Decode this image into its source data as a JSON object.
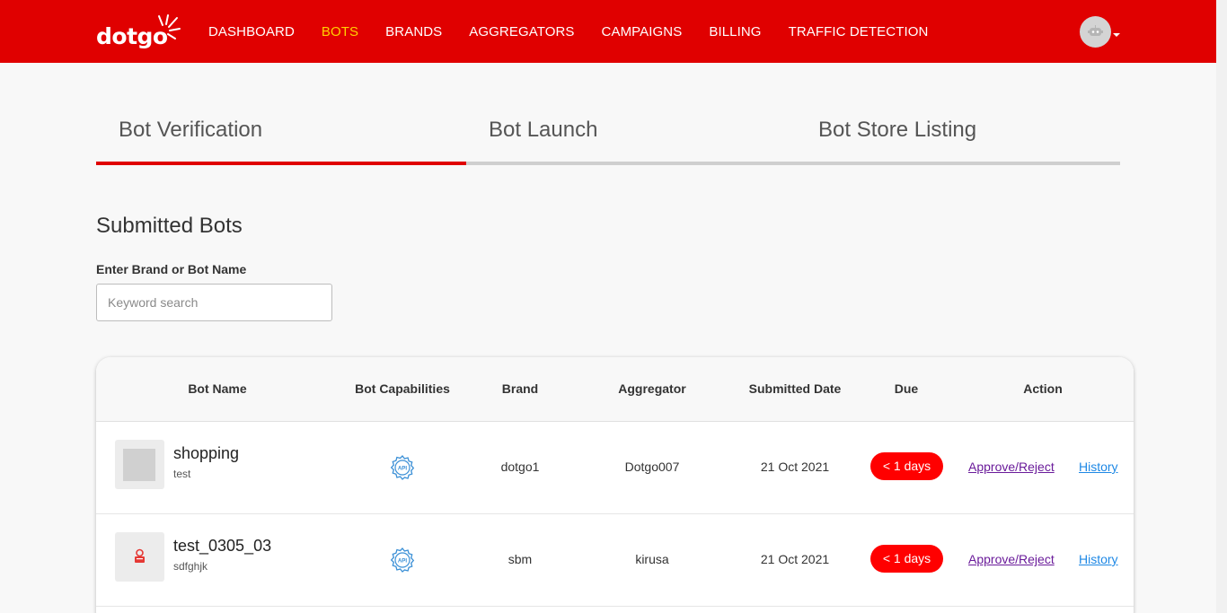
{
  "brand": {
    "logo_text": "dotgo",
    "logo_icon": "sunburst-icon",
    "color": "#e00000"
  },
  "nav": {
    "items": [
      {
        "label": "DASHBOARD",
        "active": false
      },
      {
        "label": "BOTS",
        "active": true
      },
      {
        "label": "BRANDS",
        "active": false
      },
      {
        "label": "AGGREGATORS",
        "active": false
      },
      {
        "label": "CAMPAIGNS",
        "active": false
      },
      {
        "label": "BILLING",
        "active": false
      },
      {
        "label": "TRAFFIC DETECTION",
        "active": false
      }
    ],
    "active_color": "#ffd200"
  },
  "user": {
    "avatar_icon": "robot-avatar-icon"
  },
  "tabs": [
    {
      "label": "Bot Verification",
      "active": true
    },
    {
      "label": "Bot Launch",
      "active": false
    },
    {
      "label": "Bot Store Listing",
      "active": false
    }
  ],
  "section": {
    "title": "Submitted Bots"
  },
  "search": {
    "label": "Enter Brand or Bot Name",
    "placeholder": "Keyword search",
    "value": ""
  },
  "table": {
    "headers": [
      "Bot Name",
      "Bot Capabilities",
      "Brand",
      "Aggregator",
      "Submitted Date",
      "Due",
      "Action"
    ],
    "rows": [
      {
        "bot_name": "shopping",
        "bot_desc": "test",
        "capability_icon": "api-gear-icon",
        "brand": "dotgo1",
        "aggregator": "Dotgo007",
        "submitted_date": "21 Oct 2021",
        "due": "< 1 days",
        "approve_label": "Approve/Reject",
        "history_label": "History"
      },
      {
        "bot_name": "test_0305_03",
        "bot_desc": "sdfghjk",
        "capability_icon": "api-gear-icon",
        "brand": "sbm",
        "aggregator": "kirusa",
        "submitted_date": "21 Oct 2021",
        "due": "< 1 days",
        "approve_label": "Approve/Reject",
        "history_label": "History"
      }
    ]
  }
}
